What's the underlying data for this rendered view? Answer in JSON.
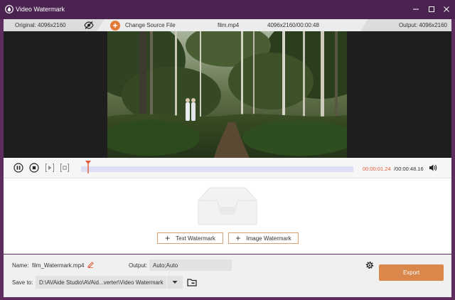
{
  "window": {
    "title": "Video Watermark"
  },
  "infobar": {
    "original": "Original: 4096x2160",
    "change_source": "Change Source File",
    "filename": "film.mp4",
    "resolution_duration": "4096x2160/00:00:48",
    "output": "Output: 4096x2160"
  },
  "playback": {
    "current_time": "00:00:01.24",
    "total_time": "/00:00:48.16",
    "progress_fraction": 0.026
  },
  "watermark": {
    "text_button": "Text Watermark",
    "image_button": "Image Watermark"
  },
  "bottom": {
    "name_label": "Name:",
    "name_value": "film_Watermark.mp4",
    "output_label": "Output:",
    "output_value": "Auto;Auto",
    "save_to_label": "Save to:",
    "save_to_path": "D:\\AVAide Studio\\AVAid...verter\\Video Watermark",
    "export_button": "Export"
  },
  "colors": {
    "accent": "#e07b39",
    "export": "#d9874a",
    "titlebar": "#4a2350",
    "time_current": "#e05a3a"
  },
  "icons": [
    "app-logo-icon",
    "minimize-icon",
    "maximize-icon",
    "close-icon",
    "eye-off-icon",
    "plus-circle-icon",
    "pause-icon",
    "stop-icon",
    "play-next-icon",
    "clip-icon",
    "volume-icon",
    "empty-tray-icon",
    "edit-icon",
    "gear-icon",
    "chevron-down-icon",
    "folder-icon"
  ]
}
